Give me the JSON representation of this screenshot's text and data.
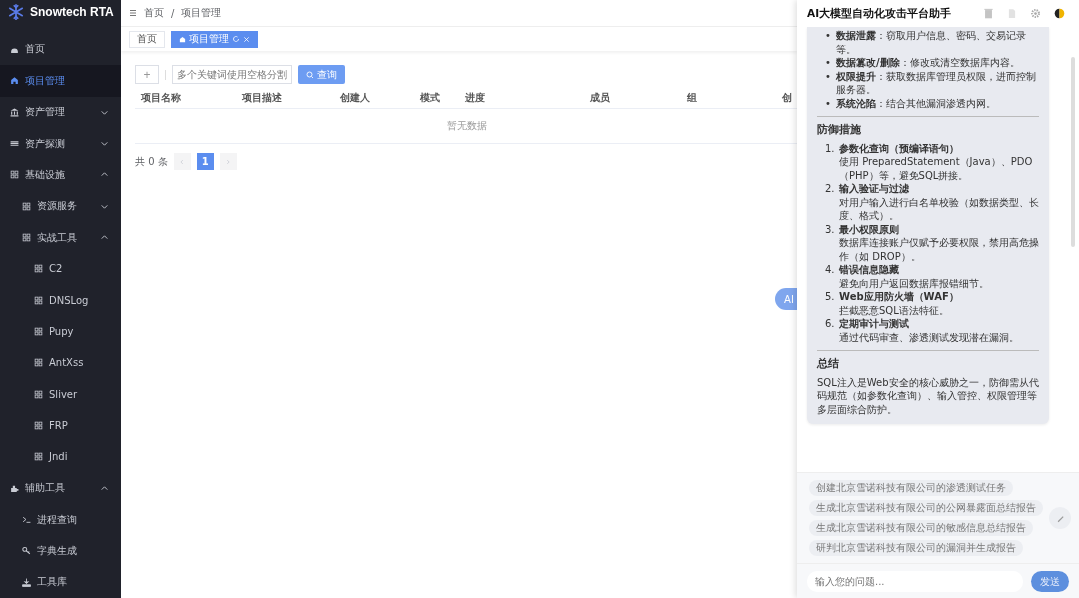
{
  "sidebar": {
    "brand": "Snowtech RTA",
    "items": [
      {
        "label": "首页",
        "selected": false
      },
      {
        "label": "项目管理",
        "selected": true
      },
      {
        "label": "资产管理",
        "selected": false,
        "expanded": false
      },
      {
        "label": "资产探测",
        "selected": false,
        "expanded": false
      },
      {
        "label": "基础设施",
        "selected": false,
        "expanded": true,
        "children": [
          {
            "label": "资源服务",
            "selected": false,
            "expanded": false
          },
          {
            "label": "实战工具",
            "selected": false,
            "expanded": true,
            "children": [
              {
                "label": "C2",
                "selected": false
              },
              {
                "label": "DNSLog",
                "selected": false
              },
              {
                "label": "Pupy",
                "selected": false
              },
              {
                "label": "AntXss",
                "selected": false
              },
              {
                "label": "Sliver",
                "selected": false
              },
              {
                "label": "FRP",
                "selected": false
              },
              {
                "label": "Jndi",
                "selected": false
              }
            ]
          }
        ]
      },
      {
        "label": "辅助工具",
        "selected": false,
        "expanded": true,
        "children": [
          {
            "label": "进程查询",
            "selected": false
          },
          {
            "label": "字典生成",
            "selected": false
          },
          {
            "label": "工具库",
            "selected": false
          }
        ]
      }
    ]
  },
  "breadcrumb": {
    "items": [
      "首页",
      "项目管理"
    ],
    "separator": "/"
  },
  "tabs": [
    {
      "label": "首页",
      "selected": false
    },
    {
      "label": "项目管理",
      "selected": true
    }
  ],
  "toolbar": {
    "add": "+",
    "search_placeholder": "多个关键词使用空格分割",
    "query": "查询"
  },
  "table": {
    "columns": [
      "项目名称",
      "项目描述",
      "创建人",
      "模式",
      "进度",
      "成员",
      "组",
      "创"
    ],
    "empty": "暂无数据"
  },
  "pagination": {
    "total": "共 0 条",
    "pages": [
      {
        "label": "1",
        "selected": true
      }
    ]
  },
  "ai_button": "AI",
  "chat": {
    "title": "AI大模型自动化攻击平台助手",
    "blocks": [
      {
        "kind": "bullets",
        "marker": "•",
        "items": [
          "**数据泄露**：窃取用户信息、密码、交易记录等。",
          "**数据篡改/删除**：修改或清空数据库内容。",
          "**权限提升**：获取数据库管理员权限，进而控制服务器。",
          "**系统沦陷**：结合其他漏洞渗透内网。"
        ]
      },
      {
        "kind": "divider"
      },
      {
        "kind": "heading",
        "text": "防御措施"
      },
      {
        "kind": "numbered",
        "items": [
          {
            "number": "1.",
            "title": "参数化查询（预编译语句）",
            "text": "使用 PreparedStatement（Java）、PDO（PHP）等，避免SQL拼接。"
          },
          {
            "number": "2.",
            "title": "输入验证与过滤",
            "text": "对用户输入进行白名单校验（如数据类型、长度、格式）。"
          },
          {
            "number": "3.",
            "title": "最小权限原则",
            "text": "数据库连接账户仅赋予必要权限，禁用高危操作（如 DROP）。"
          },
          {
            "number": "4.",
            "title": "错误信息隐藏",
            "text": "避免向用户返回数据库报错细节。"
          },
          {
            "number": "5.",
            "title": "Web应用防火墙（WAF）",
            "text": "拦截恶意SQL语法特征。"
          },
          {
            "number": "6.",
            "title": "定期审计与测试",
            "text": "通过代码审查、渗透测试发现潜在漏洞。"
          }
        ]
      },
      {
        "kind": "divider"
      },
      {
        "kind": "heading",
        "text": "总结"
      },
      {
        "kind": "paragraph",
        "text": "SQL注入是Web安全的核心威胁之一，防御需从代码规范（如参数化查询）、输入管控、权限管理等多层面综合防护。"
      }
    ],
    "suggestions": [
      "创建北京雪诺科技有限公司的渗透测试任务",
      "生成北京雪诺科技有限公司的公网暴露面总结报告",
      "生成北京雪诺科技有限公司的敏感信息总结报告",
      "研判北京雪诺科技有限公司的漏洞并生成报告"
    ],
    "input_placeholder": "输入您的问题...",
    "send": "发送"
  }
}
